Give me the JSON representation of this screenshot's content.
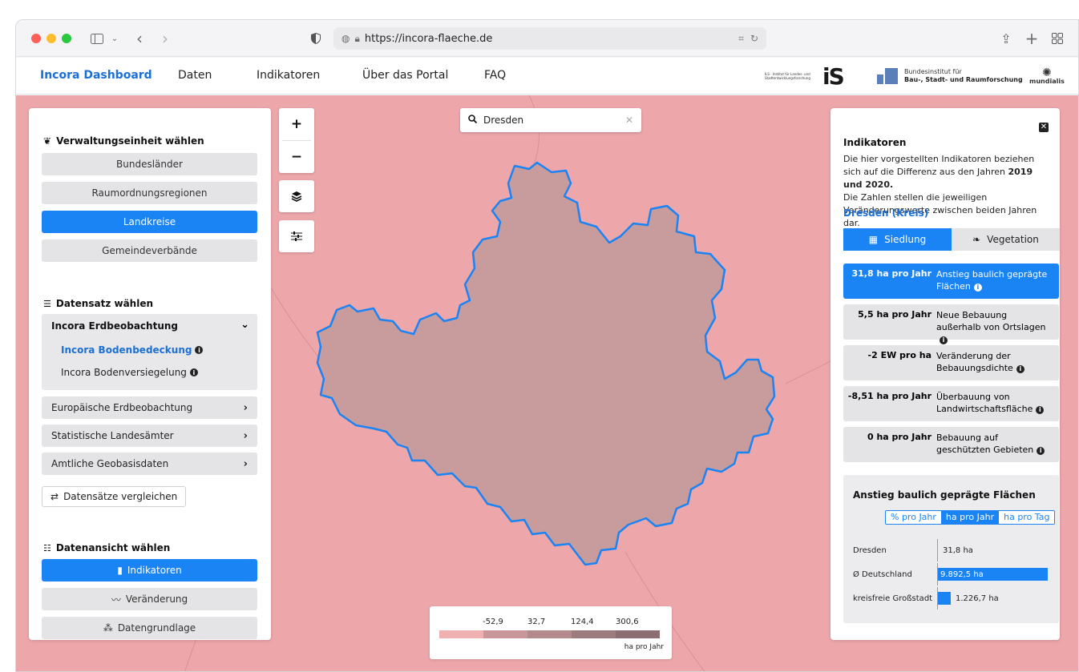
{
  "browser": {
    "url": "https://incora-flaeche.de",
    "title_icons": [
      "sidebar-icon",
      "chevron-down-icon",
      "back-icon",
      "forward-icon",
      "shield-icon",
      "globe-icon",
      "lock-icon",
      "translate-icon",
      "reload-icon",
      "share-icon",
      "plus-icon",
      "grid-icon"
    ]
  },
  "nav": {
    "brand": "Incora Dashboard",
    "items": [
      "Daten",
      "Indikatoren",
      "Über das Portal",
      "FAQ"
    ],
    "logos": {
      "ils": "ILS · Institut für Landes- und Stadtentwicklungsforschung",
      "ils_short": "iS",
      "bbsr_line1": "Bundesinstitut für",
      "bbsr_line2": "Bau-, Stadt- und Raumforschung",
      "mundialis": "mundialis"
    }
  },
  "left": {
    "admin_title": "Verwaltungseinheit wählen",
    "admin_buttons": [
      "Bundesländer",
      "Raumordnungsregionen",
      "Landkreise",
      "Gemeindeverbände"
    ],
    "admin_active": "Landkreise",
    "dataset_title": "Datensatz wählen",
    "dataset_group": "Incora Erdbeobachtung",
    "dataset_items": [
      "Incora Bodenbedeckung",
      "Incora Bodenversiegelung"
    ],
    "other_groups": [
      "Europäische Erdbeobachtung",
      "Statistische Landesämter",
      "Amtliche Geobasisdaten"
    ],
    "compare_label": "Datensätze vergleichen",
    "view_title": "Datenansicht wählen",
    "view_buttons": [
      "Indikatoren",
      "Veränderung",
      "Datengrundlage"
    ]
  },
  "map": {
    "search_value": "Dresden",
    "zoom_in": "+",
    "zoom_out": "−",
    "legend": {
      "ticks": [
        "-52,9",
        "32,7",
        "124,4",
        "300,6"
      ],
      "unit": "ha pro Jahr",
      "colors": [
        "#efb0b2",
        "#c9979a",
        "#b48a8d",
        "#9c7b7e",
        "#8a6e71"
      ]
    },
    "colors": {
      "background": "#eda7ab",
      "region_fill": "#c89b9c",
      "region_stroke": "#1a84f5"
    }
  },
  "right": {
    "title": "Indikatoren",
    "desc_1": "Die hier vorgestellten Indikatoren beziehen sich auf die Differenz aus den Jahren ",
    "desc_bold": "2019 und 2020.",
    "desc_2": "Die Zahlen stellen die jeweiligen Veränderungswerte zwischen beiden Jahren dar.",
    "region": "Dresden (Kreis)",
    "tabs": [
      "Siedlung",
      "Vegetation"
    ],
    "indicators": [
      {
        "value": "31,8  ha pro Jahr",
        "label": "Anstieg baulich geprägte Flächen"
      },
      {
        "value": "5,5  ha pro Jahr",
        "label": "Neue Bebauung außerhalb von Ortslagen"
      },
      {
        "value": "-2  EW pro ha",
        "label": "Veränderung der Bebauungsdichte"
      },
      {
        "value": "-8,51  ha pro Jahr",
        "label": "Überbauung von Landwirtschaftsfläche"
      },
      {
        "value": "0  ha pro Jahr",
        "label": "Bebauung auf geschützten Gebieten"
      }
    ],
    "compare": {
      "title": "Anstieg baulich geprägte Flächen",
      "units": [
        "% pro Jahr",
        "ha pro Jahr",
        "ha pro Tag"
      ],
      "selected_unit": "ha pro Jahr",
      "rows": [
        {
          "name": "Dresden",
          "value": "31,8 ha",
          "amount": 31.8
        },
        {
          "name": "Ø Deutschland",
          "value": "9.892,5 ha",
          "amount": 9892.5
        },
        {
          "name": "kreisfreie Großstadt",
          "value": "1.226,7 ha",
          "amount": 1226.7
        }
      ]
    }
  }
}
